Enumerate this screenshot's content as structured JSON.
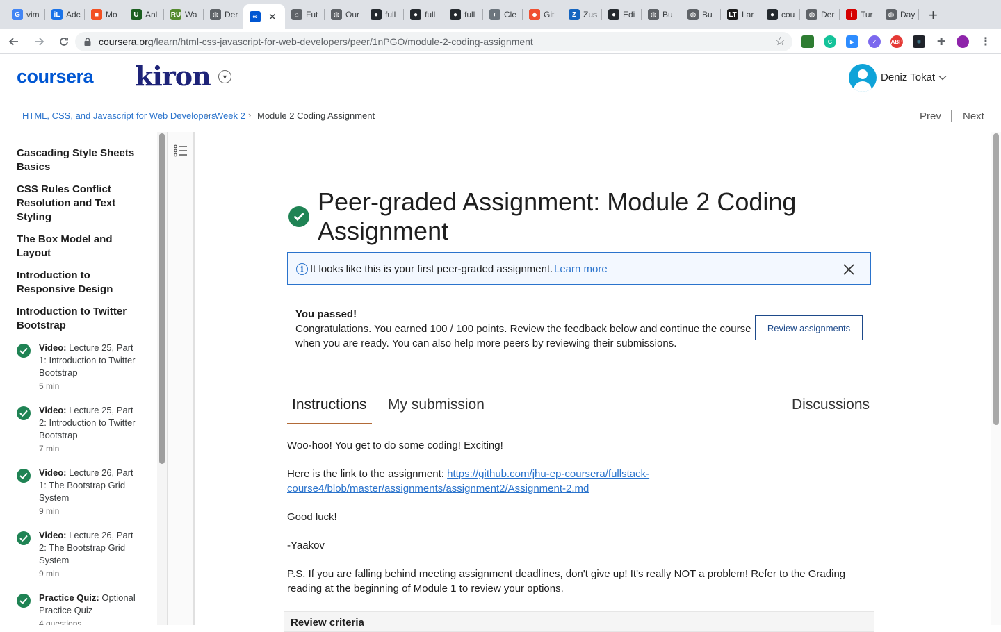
{
  "browser": {
    "tabs": [
      {
        "label": "vim",
        "icon": "google-icon",
        "color": "#4285f4",
        "glyph": "G"
      },
      {
        "label": "Adc",
        "icon": "il-icon",
        "color": "#1a73e8",
        "glyph": "iL"
      },
      {
        "label": "Mo",
        "icon": "windows-icon",
        "color": "#f25022",
        "glyph": "■"
      },
      {
        "label": "Anl",
        "icon": "u-icon",
        "color": "#1b5e20",
        "glyph": "U"
      },
      {
        "label": "Wa",
        "icon": "ru-icon",
        "color": "#558b2f",
        "glyph": "RU"
      },
      {
        "label": "Der",
        "icon": "globe-icon",
        "color": "#5f6368",
        "glyph": "◍"
      },
      {
        "label": "",
        "icon": "coursera-icon",
        "color": "#0056d2",
        "glyph": "∞",
        "active": true
      },
      {
        "label": "Fut",
        "icon": "store-icon",
        "color": "#5f6368",
        "glyph": "⌂"
      },
      {
        "label": "Our",
        "icon": "globe-icon",
        "color": "#5f6368",
        "glyph": "◍"
      },
      {
        "label": "full",
        "icon": "github-icon",
        "color": "#24292e",
        "glyph": "●"
      },
      {
        "label": "full",
        "icon": "github-icon",
        "color": "#24292e",
        "glyph": "●"
      },
      {
        "label": "full",
        "icon": "github-icon",
        "color": "#24292e",
        "glyph": "●"
      },
      {
        "label": "Cle",
        "icon": "clerk-icon",
        "color": "#6c757d",
        "glyph": "◐"
      },
      {
        "label": "Git",
        "icon": "git-icon",
        "color": "#f05032",
        "glyph": "◆"
      },
      {
        "label": "Zus",
        "icon": "zustand-icon",
        "color": "#1565c0",
        "glyph": "Z"
      },
      {
        "label": "Edi",
        "icon": "github-icon",
        "color": "#24292e",
        "glyph": "●"
      },
      {
        "label": "Bu",
        "icon": "globe-icon",
        "color": "#5f6368",
        "glyph": "◍"
      },
      {
        "label": "Bu",
        "icon": "globe-icon",
        "color": "#5f6368",
        "glyph": "◍"
      },
      {
        "label": "Lar",
        "icon": "lt-icon",
        "color": "#1a1a1a",
        "glyph": "LT"
      },
      {
        "label": "cou",
        "icon": "github-icon",
        "color": "#24292e",
        "glyph": "●"
      },
      {
        "label": "Der",
        "icon": "globe-icon",
        "color": "#5f6368",
        "glyph": "◍"
      },
      {
        "label": "Tur",
        "icon": "tur-icon",
        "color": "#d50000",
        "glyph": "i"
      },
      {
        "label": "Day",
        "icon": "globe-icon",
        "color": "#5f6368",
        "glyph": "◍"
      }
    ],
    "url_host": "coursera.org",
    "url_path": "/learn/html-css-javascript-for-web-developers/peer/1nPGO/module-2-coding-assignment"
  },
  "header": {
    "logo": "coursera",
    "partner": "kiron",
    "user_name": "Deniz Tokat"
  },
  "breadcrumb": {
    "course": "HTML, CSS, and Javascript for Web Developers",
    "week": "Week 2",
    "current": "Module 2 Coding Assignment",
    "prev": "Prev",
    "next": "Next"
  },
  "sidebar": {
    "sections": [
      "Cascading Style Sheets Basics",
      "CSS Rules Conflict Resolution and Text Styling",
      "The Box Model and Layout",
      "Introduction to Responsive Design",
      "Introduction to Twitter Bootstrap"
    ],
    "items": [
      {
        "type": "Video:",
        "title": "Lecture 25, Part 1: Introduction to Twitter Bootstrap",
        "duration": "5 min"
      },
      {
        "type": "Video:",
        "title": "Lecture 25, Part 2: Introduction to Twitter Bootstrap",
        "duration": "7 min"
      },
      {
        "type": "Video:",
        "title": "Lecture 26, Part 1: The Bootstrap Grid System",
        "duration": "9 min"
      },
      {
        "type": "Video:",
        "title": "Lecture 26, Part 2: The Bootstrap Grid System",
        "duration": "9 min"
      },
      {
        "type": "Practice Quiz:",
        "title": "Optional Practice Quiz",
        "duration": "4 questions"
      }
    ]
  },
  "main": {
    "title": "Peer-graded Assignment: Module 2 Coding Assignment",
    "info": {
      "text": "It looks like this is your first peer-graded assignment.",
      "link": "Learn more"
    },
    "pass": {
      "heading": "You passed!",
      "text": "Congratulations. You earned 100 / 100 points. Review the feedback below and continue the course when you are ready. You can also help more peers by reviewing their submissions.",
      "button": "Review assignments"
    },
    "tabs": {
      "instructions": "Instructions",
      "submission": "My submission",
      "discussions": "Discussions"
    },
    "body": {
      "p1": "Woo-hoo! You get to do some coding! Exciting!",
      "p2_prefix": "Here is the link to the assignment:",
      "p2_link": "https://github.com/jhu-ep-coursera/fullstack-course4/blob/master/assignments/assignment2/Assignment-2.md",
      "p3": "Good luck!",
      "p4": "-Yaakov",
      "p5": "P.S. If you are falling behind meeting assignment deadlines, don't give up! It's really NOT a problem! Refer to the Grading reading at the beginning of Module 1 to review your options."
    },
    "criteria_label": "Review criteria"
  },
  "colors": {
    "brand": "#0056d2",
    "link": "#2a73cc",
    "success": "#1f8354",
    "tab_accent": "#b26a37"
  }
}
